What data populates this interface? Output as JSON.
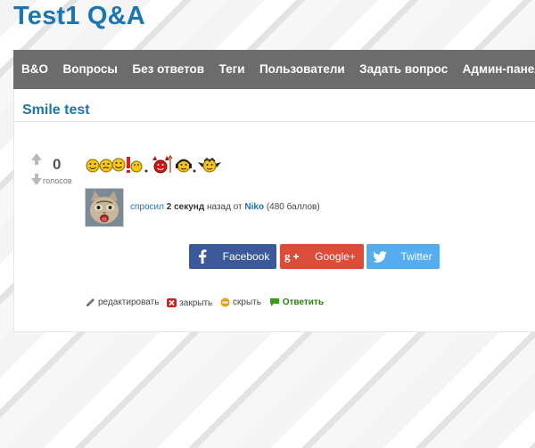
{
  "site": {
    "title": "Test1 Q&A"
  },
  "nav": {
    "items": [
      "B&O",
      "Вопросы",
      "Без ответов",
      "Теги",
      "Пользователи",
      "Задать вопрос",
      "Админ-панель"
    ]
  },
  "question": {
    "title": "Smile test",
    "votes": {
      "count": "0",
      "label": "голосов"
    },
    "emojis": [
      "smile-face-icon",
      "smile-face-icon",
      "smile-face-icon",
      "exclamation-face-icon",
      "devil-face-icon",
      "headphones-face-icon",
      "bat-face-icon"
    ],
    "meta": {
      "asked": "спросил",
      "time": "2 секунд",
      "ago": "назад от",
      "user": "Niko",
      "points": "(480 баллов)"
    }
  },
  "share": {
    "facebook": "Facebook",
    "google": "Google+",
    "twitter": "Twitter"
  },
  "actions": {
    "edit": "редактировать",
    "close": "закрыть",
    "hide": "скрыть",
    "answer": "Ответить"
  },
  "colors": {
    "brand": "#1a76b0",
    "nav_bg": "#6c6c6c",
    "facebook": "#3b5998",
    "google": "#dd4b39",
    "twitter": "#55acee",
    "answer": "#2e7d14"
  }
}
